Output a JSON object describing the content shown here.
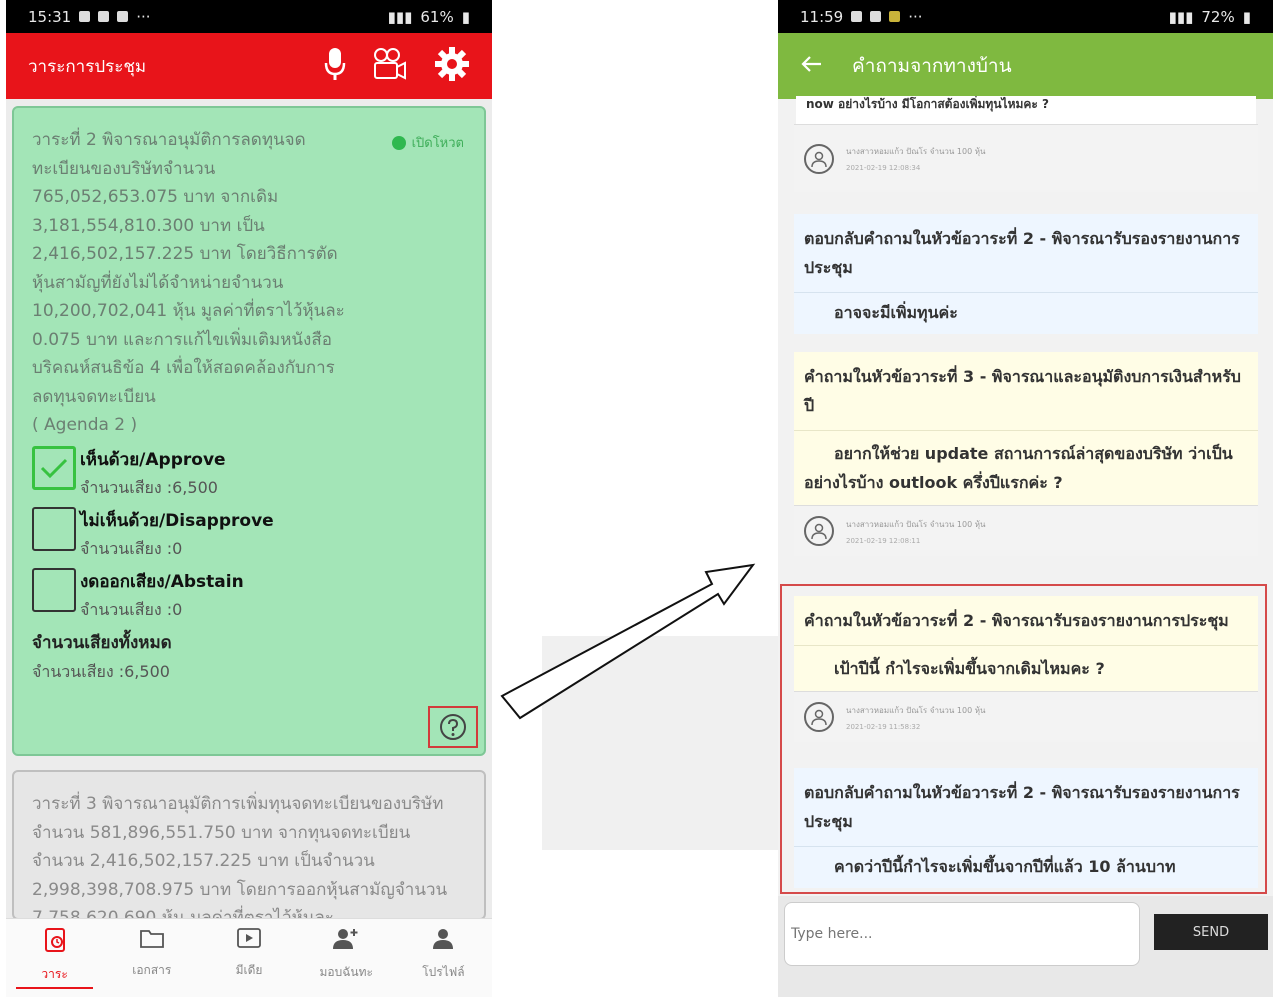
{
  "left": {
    "status": {
      "time": "15:31",
      "battery": "61%"
    },
    "appbar": {
      "title": "วาระการประชุม"
    },
    "agenda2": {
      "text": "วาระที่ 2 พิจารณาอนุมัติการลดทุนจดทะเบียนของบริษัทจำนวน 765,052,653.075 บาท จากเดิม 3,181,554,810.300 บาท เป็น 2,416,502,157.225 บาท โดยวิธีการตัดหุ้นสามัญที่ยังไม่ได้จำหน่ายจำนวน 10,200,702,041 หุ้น มูลค่าที่ตราไว้หุ้นละ 0.075 บาท และการแก้ไขเพิ่มเติมหนังสือบริคณห์สนธิข้อ 4 เพื่อให้สอดคล้องกับการลดทุนจดทะเบียน",
      "tag": "( Agenda 2 )",
      "status_label": "เปิดโหวต",
      "votes": [
        {
          "label": "เห็นด้วย/Approve",
          "count": "จำนวนเสียง :6,500",
          "checked": true
        },
        {
          "label": "ไม่เห็นด้วย/Disapprove",
          "count": "จำนวนเสียง :0",
          "checked": false
        },
        {
          "label": "งดออกเสียง/Abstain",
          "count": "จำนวนเสียง :0",
          "checked": false
        }
      ],
      "total_title": "จำนวนเสียงทั้งหมด",
      "total_count": "จำนวนเสียง :6,500"
    },
    "agenda3": {
      "text": "วาระที่ 3 พิจารณาอนุมัติการเพิ่มทุนจดทะเบียนของบริษัทจำนวน 581,896,551.750 บาท จากทุนจดทะเบียนจำนวน 2,416,502,157.225 บาท เป็นจำนวน 2,998,398,708.975 บาท โดยการออกหุ้นสามัญจำนวน 7,758,620,690 หุ้น มูลค่าที่ตราไว้หุ้นละ"
    },
    "nav": [
      {
        "label": "วาระ",
        "icon": "agenda-icon",
        "active": true
      },
      {
        "label": "เอกสาร",
        "icon": "folder-icon",
        "active": false
      },
      {
        "label": "มีเดีย",
        "icon": "media-icon",
        "active": false
      },
      {
        "label": "มอบฉันทะ",
        "icon": "add-proxy-icon",
        "active": false
      },
      {
        "label": "โปรไฟล์",
        "icon": "profile-icon",
        "active": false
      }
    ]
  },
  "right": {
    "status": {
      "time": "11:59",
      "battery": "72%"
    },
    "appbar": {
      "title": "คำถามจากทางบ้าน"
    },
    "cut_text": "now อย่างไรบ้าง มีโอกาสต้องเพิ่มทุนไหมคะ ?",
    "meta_name": "นางสาวหอมแก้ว ปัณโร จำนวน 100 หุ้น",
    "items": [
      {
        "kind": "answer",
        "head": "ตอบกลับคำถามในหัวข้อวาระที่ 2 - พิจารณารับรองรายงานการประชุม",
        "body": "อาจจะมีเพิ่มทุนค่ะ"
      },
      {
        "kind": "question",
        "head": "คำถามในหัวข้อวาระที่ 3 - พิจารณาและอนุมัติงบการเงินสำหรับปี",
        "body": "อยากให้ช่วย update สถานการณ์ล่าสุดของบริษัท ว่าเป็นอย่างไรบ้าง outlook ครึ่งปีแรกค่ะ ?",
        "time": "2021-02-19 12:08:11"
      },
      {
        "kind": "question",
        "head": "คำถามในหัวข้อวาระที่ 2 - พิจารณารับรองรายงานการประชุม",
        "body": "เป้าปีนี้ กำไรจะเพิ่มขึ้นจากเดิมไหมคะ ?",
        "time": "2021-02-19 11:58:32"
      },
      {
        "kind": "answer",
        "head": "ตอบกลับคำถามในหัวข้อวาระที่ 2 - พิจารณารับรองรายงานการประชุม",
        "body": "คาดว่าปีนี้กำไรจะเพิ่มขึ้นจากปีที่แล้ว 10 ล้านบาท"
      }
    ],
    "first_time": "2021-02-19 12:08:34",
    "input": {
      "placeholder": "Type here..."
    },
    "send_label": "SEND"
  }
}
